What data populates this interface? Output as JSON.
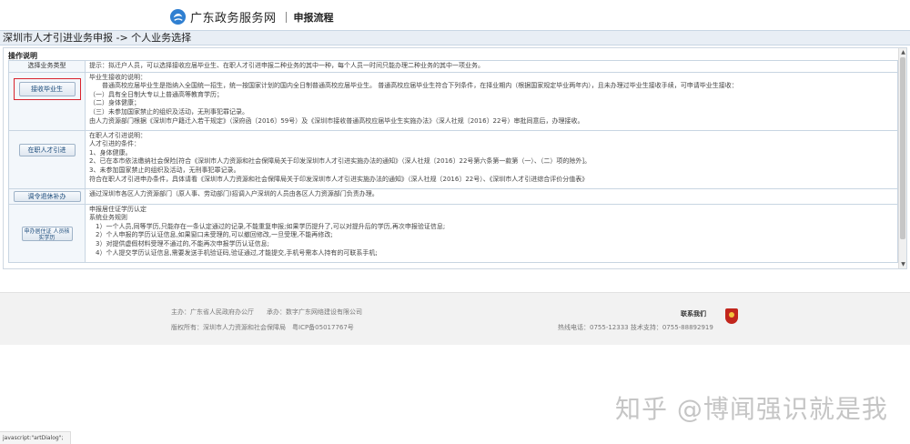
{
  "header": {
    "site_name": "广东政务服务网",
    "section": "申报流程"
  },
  "breadcrumb": "深圳市人才引进业务申报 -> 个人业务选择",
  "ops": {
    "section_label": "操作说明",
    "head_left": "选择业务类型",
    "head_right": "提示：拟迁户人员，可以选择接收应届毕业生、在职人才引进申报二种业务的其中一种，每个人员一时间只能办理二种业务的其中一项业务。",
    "rows": [
      {
        "button": "接收毕业生",
        "lines": [
          "毕业生接收的说明：",
          "　　普通高校应届毕业生是指纳入全国统一招生，统一按国家计划的国内全日制普通高校应届毕业生。 普通高校应届毕业生符合下列条件，在择业期内（根据国家规定毕业两年内），且未办理过毕业生接收手续，可申请毕业生接收：",
          "（一）具有全日制大专以上普通高等教育学历；",
          "（二）身体健康；",
          "（三）未参加国家禁止的组织及活动，无刑事犯罪记录。",
          "由人力资源部门根据《深圳市户籍迁入若干规定》（深府函〔2016〕59号）及《深圳市接收普通高校应届毕业生实施办法》（深人社规〔2016〕22号）审批同意后，办理接收。"
        ]
      },
      {
        "button": "在职人才引进",
        "lines": [
          "在职人才引进说明：",
          "人才引进的条件：",
          "1、身体健康。",
          "2、已在本市依法缴纳社会保险[符合《深圳市人力资源和社会保障局关于印发深圳市人才引进实施办法的通知》（深人社规〔2016〕22号第六条第一款第（一）、（二）项的除外]。",
          "3、未参加国家禁止的组织及活动，无刑事犯罪记录。",
          "符合在职人才引进申办条件，具体请看《深圳市人力资源和社会保障局关于印发深圳市人才引进实施办法的通知》（深人社规〔2016〕22号）、《深圳市人才引进综合评价分值表》"
        ]
      },
      {
        "button": "调令退休补办",
        "lines": [
          "通过深圳市各区人力资源部门（原人事、劳动部门)招调入户深圳的人员由各区人力资源部门负责办理。"
        ]
      },
      {
        "button": "申办居住证 人员核实学历",
        "lines": [
          "申报居住证学历认定",
          "系统业务规则",
          "　1）一个人员,同等学历,只能存在一条认定通过的记录,不能重复申报;如果学历提升了,可以对提升后的学历,再次申报验证信息;",
          "　2）个人申报的学历认证信息,如果窗口未受理的,可以撤回修改,一旦受理,不能再修改;",
          "　3）对提供虚假材料受理不通过的,不能再次申报学历认证信息;",
          "　4）个人提交学历认证信息,需要发送手机验证码,验证通过,才能提交,手机号需本人持有的可联系手机;"
        ]
      }
    ]
  },
  "footer": {
    "host": "主办：广东省人民政府办公厅　　承办：数字广东网络建设有限公司",
    "copyright": "版权所有：深圳市人力资源和社会保障局　粤ICP备05017767号",
    "contact": "联系我们",
    "phones": "热线电话：0755-12333 技术支持：0755-88892919"
  },
  "watermark": "知乎 @博闻强识就是我",
  "statusbar": "javascript:\"artDialog\";",
  "colors": {
    "accent": "#1a4a7a",
    "highlight": "#d9232d",
    "breadcrumb_bg": "#e8eef5",
    "footer_bg": "#f2f2f2"
  }
}
